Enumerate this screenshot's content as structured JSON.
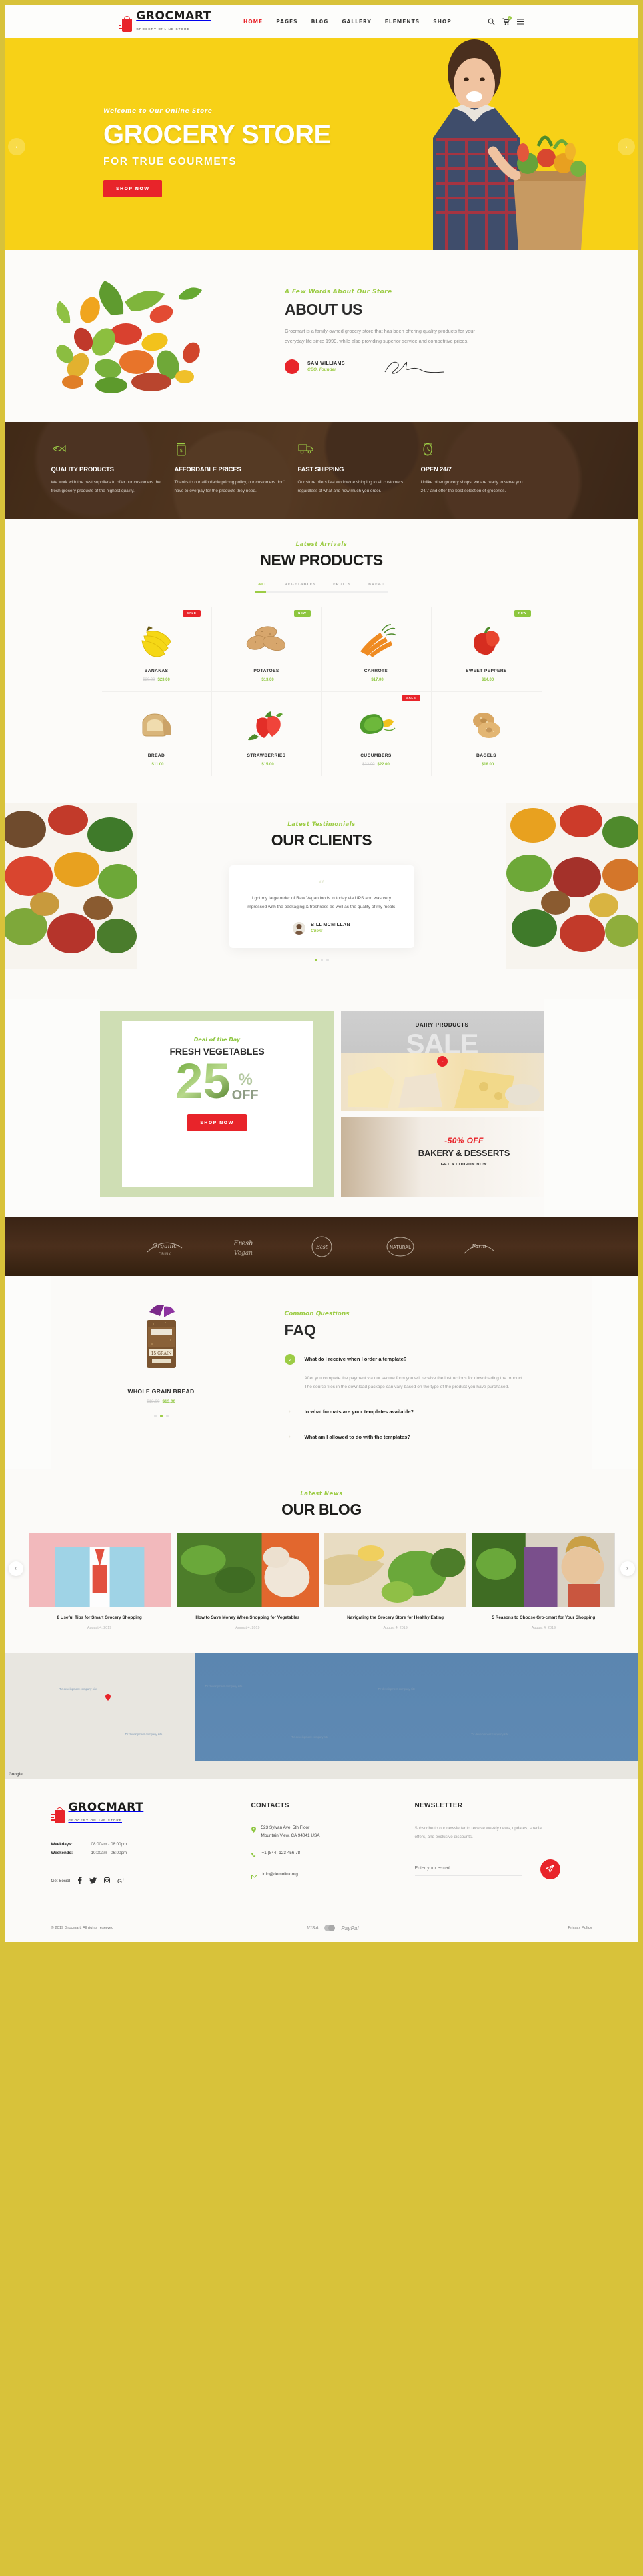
{
  "brand": {
    "name": "GROCMART",
    "tagline": "GROCERY ONLINE STORE"
  },
  "colors": {
    "accent_red": "#e8242a",
    "accent_green": "#9ccc45",
    "hero_yellow": "#f7d117",
    "border_gold": "#d8c23a"
  },
  "nav": {
    "items": [
      {
        "label": "HOME",
        "active": true
      },
      {
        "label": "PAGES",
        "active": false
      },
      {
        "label": "BLOG",
        "active": false
      },
      {
        "label": "GALLERY",
        "active": false
      },
      {
        "label": "ELEMENTS",
        "active": false
      },
      {
        "label": "SHOP",
        "active": false
      }
    ],
    "cart_count": "2"
  },
  "hero": {
    "subtitle": "Welcome to Our Online Store",
    "title": "GROCERY STORE",
    "subtitle2": "FOR TRUE GOURMETS",
    "cta": "SHOP NOW",
    "prev": "‹",
    "next": "›"
  },
  "about": {
    "eyebrow": "A Few Words About Our Store",
    "title": "ABOUT US",
    "text": "Grocmart is a family-owned grocery store that has been offering quality products for your everyday life since 1999, while also providing superior service and competitive prices.",
    "person_name": "SAM WILLIAMS",
    "person_role": "CEO, Founder"
  },
  "features": [
    {
      "icon": "fish-icon",
      "title": "QUALITY PRODUCTS",
      "text": "We work with the best suppliers to offer our customers the fresh grocery products of the highest quality."
    },
    {
      "icon": "price-tag-icon",
      "title": "AFFORDABLE PRICES",
      "text": "Thanks to our affordable pricing policy, our customers don't have to overpay for the products they need."
    },
    {
      "icon": "truck-icon",
      "title": "FAST SHIPPING",
      "text": "Our store offers fast worldwide shipping to all customers regardless of what and how much you order."
    },
    {
      "icon": "clock-icon",
      "title": "OPEN 24/7",
      "text": "Unlike other grocery shops, we are ready to serve you 24/7 and offer the best selection of groceries."
    }
  ],
  "products_section": {
    "eyebrow": "Latest Arrivals",
    "title": "NEW PRODUCTS",
    "filters": [
      {
        "label": "ALL",
        "active": true
      },
      {
        "label": "VEGETABLES",
        "active": false
      },
      {
        "label": "FRUITS",
        "active": false
      },
      {
        "label": "BREAD",
        "active": false
      }
    ],
    "items": [
      {
        "name": "BANANAS",
        "old_price": "$30.00",
        "price": "$23.00",
        "badge": "SALE",
        "badge_type": "sale"
      },
      {
        "name": "POTATOES",
        "old_price": "",
        "price": "$13.00",
        "badge": "NEW",
        "badge_type": "new"
      },
      {
        "name": "CARROTS",
        "old_price": "",
        "price": "$17.00",
        "badge": "",
        "badge_type": ""
      },
      {
        "name": "SWEET PEPPERS",
        "old_price": "",
        "price": "$14.00",
        "badge": "NEW",
        "badge_type": "new"
      },
      {
        "name": "BREAD",
        "old_price": "",
        "price": "$11.00",
        "badge": "",
        "badge_type": ""
      },
      {
        "name": "STRAWBERRIES",
        "old_price": "",
        "price": "$15.00",
        "badge": "",
        "badge_type": ""
      },
      {
        "name": "CUCUMBERS",
        "old_price": "$32.00",
        "price": "$22.00",
        "badge": "SALE",
        "badge_type": "sale"
      },
      {
        "name": "BAGELS",
        "old_price": "",
        "price": "$18.00",
        "badge": "",
        "badge_type": ""
      }
    ]
  },
  "clients": {
    "eyebrow": "Latest Testimonials",
    "title": "OUR CLIENTS",
    "quote_mark": "“",
    "text": "I got my large order of Raw Vegan foods in today via UPS and was very impressed with the packaging & freshness as well as the quality of my meals.",
    "author": "BILL MCMILLAN",
    "role": "Client"
  },
  "promo": {
    "deal_eyebrow": "Deal of the Day",
    "deal_title": "FRESH VEGETABLES",
    "deal_number": "25",
    "deal_percent": "%",
    "deal_off": "OFF",
    "deal_cta": "SHOP NOW",
    "dairy_title": "DAIRY PRODUCTS",
    "dairy_sale": "SALE",
    "bakery_discount": "-50% OFF",
    "bakery_title": "BAKERY & DESSERTS",
    "bakery_cta": "GET A COUPON NOW"
  },
  "brands": [
    {
      "name": "Organic Drink"
    },
    {
      "name": "Fresh Vegan"
    },
    {
      "name": "Best Quality"
    },
    {
      "name": "Natural Food"
    },
    {
      "name": "Farm Market"
    }
  ],
  "faq": {
    "eyebrow": "Common Questions",
    "title": "FAQ",
    "product_name": "WHOLE GRAIN BREAD",
    "product_old_price": "$18.00",
    "product_price": "$13.00",
    "items": [
      {
        "question": "What do I receive when I order a template?",
        "open": true,
        "answer": "After you complete the payment via our secure form you will receive the instructions for downloading the product. The source files in the download package can vary based on the type of the product you have purchased."
      },
      {
        "question": "In what formats are your templates available?",
        "open": false,
        "answer": ""
      },
      {
        "question": "What am I allowed to do with the templates?",
        "open": false,
        "answer": ""
      }
    ]
  },
  "blog": {
    "eyebrow": "Latest News",
    "title": "OUR BLOG",
    "posts": [
      {
        "title": "8 Useful Tips for Smart Grocery Shopping",
        "date": "August 4, 2019"
      },
      {
        "title": "How to Save Money When Shopping for Vegetables",
        "date": "August 4, 2019"
      },
      {
        "title": "Navigating the Grocery Store for Healthy Eating",
        "date": "August 4, 2019"
      },
      {
        "title": "5 Reasons to Choose Gro-cmart for Your Shopping",
        "date": "August 4, 2019"
      }
    ],
    "prev": "‹",
    "next": "›"
  },
  "map": {
    "labels": [
      "TV development company site",
      "TV development company site",
      "TV development company site",
      "TV development company site",
      "TV development company site",
      "TV development company site"
    ],
    "watermark": "Google"
  },
  "footer": {
    "hours": [
      {
        "label": "Weekdays:",
        "value": "08:00am - 08:00pm"
      },
      {
        "label": "Weekends:",
        "value": "10:00am - 06:00pm"
      }
    ],
    "get_social": "Get Social",
    "social_icons": [
      "facebook-icon",
      "twitter-icon",
      "instagram-icon",
      "google-plus-icon"
    ],
    "contacts_title": "CONTACTS",
    "address_line1": "523 Sylvan Ave, 5th Floor",
    "address_line2": "Mountain View, CA 94041 USA",
    "phone": "+1 (844) 123 456 78",
    "email": "info@demolink.org",
    "newsletter_title": "NEWSLETTER",
    "newsletter_text": "Subscribe to our newsletter to receive weekly news, updates, special offers, and exclusive discounts.",
    "newsletter_placeholder": "Enter your e-mail",
    "copyright": "© 2019 Grocmart. All rights reserved",
    "pay_visa": "VISA",
    "pay_paypal": "PayPal",
    "privacy": "Privacy Policy"
  }
}
